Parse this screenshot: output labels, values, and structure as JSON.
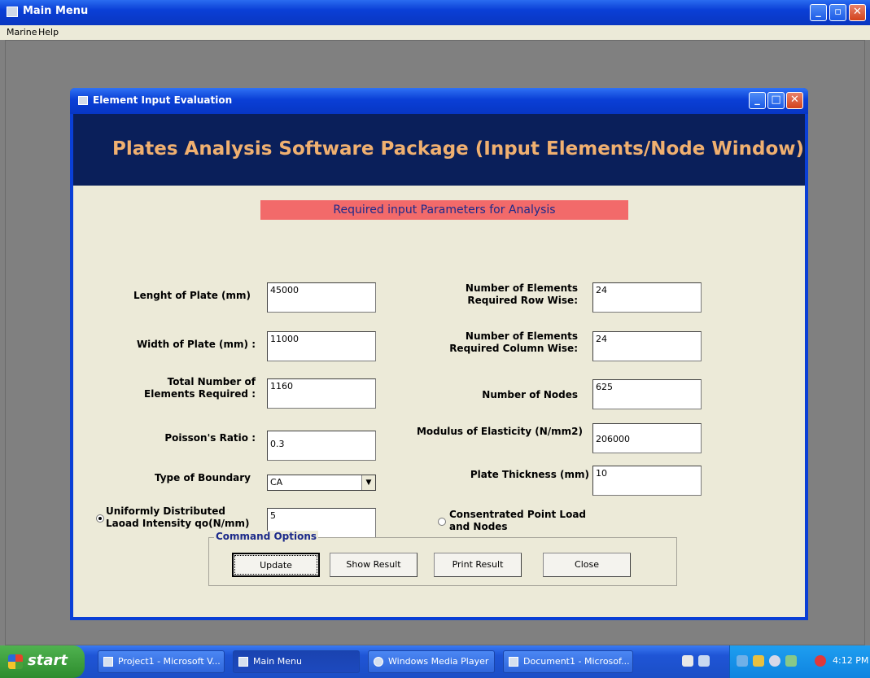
{
  "main_window": {
    "title": "Main Menu",
    "min_label": "_",
    "max_label": "▫",
    "close_label": "✕"
  },
  "menu": {
    "items": [
      "Marine",
      "Help"
    ]
  },
  "child_window": {
    "title": "Element Input Evaluation",
    "banner": "Plates Analysis Software Package (Input Elements/Node Window)",
    "required_header": "Required input Parameters for Analysis",
    "min_label": "_",
    "max_label": "□",
    "close_label": "✕"
  },
  "form": {
    "length_label": "Lenght of Plate (mm)",
    "length_value": "45000",
    "width_label": "Width of Plate (mm) :",
    "width_value": "11000",
    "total_elements_label": "Total Number of Elements Required :",
    "total_elements_value": "1160",
    "poisson_label": "Poisson's Ratio :",
    "poisson_value": "0.3",
    "boundary_label": "Type of Boundary",
    "boundary_value": "CA",
    "udl_label": "Uniformly Distributed Laoad Intensity qo(N/mm)",
    "udl_value": "5",
    "row_elements_label": "Number of Elements Required  Row Wise:",
    "row_elements_value": "24",
    "col_elements_label": "Number of Elements Required Column Wise:",
    "col_elements_value": "24",
    "nodes_label": "Number of Nodes",
    "nodes_value": "625",
    "modulus_label": "Modulus of Elasticity (N/mm2)",
    "modulus_value": "206000",
    "thickness_label": "Plate Thickness (mm)",
    "thickness_value": "10",
    "point_load_label": "Consentrated Point Load and Nodes"
  },
  "commands": {
    "group_title": "Command Options",
    "update": "Update",
    "show_result": "Show Result",
    "print_result": "Print Result",
    "close": "Close"
  },
  "taskbar": {
    "start": "start",
    "tasks": [
      "Project1 - Microsoft V...",
      "Main Menu",
      "Windows Media Player",
      "Document1 - Microsof..."
    ],
    "clock": "4:12 PM"
  }
}
